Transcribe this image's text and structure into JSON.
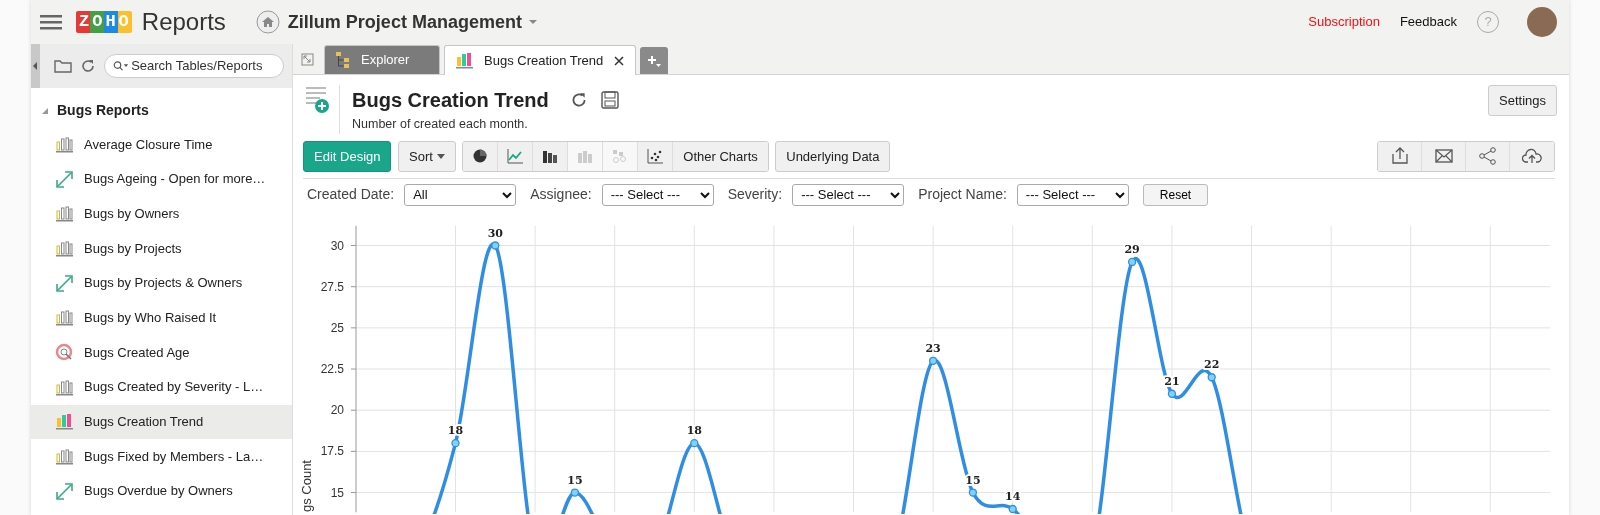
{
  "header": {
    "brand": "ZOHO",
    "app_name": "Reports",
    "workspace": "Zillum Project Management",
    "links": [
      {
        "label": "Subscription",
        "kind": "upgrade"
      },
      {
        "label": "Feedback",
        "kind": "plain"
      }
    ],
    "help": "?"
  },
  "sidebar": {
    "search": {
      "placeholder": "Search Tables/Reports"
    },
    "section": {
      "title": "Bugs Reports",
      "expanded": true
    },
    "items": [
      {
        "label": "Average Closure Time",
        "kind": "bar",
        "selected": false
      },
      {
        "label": "Bugs Ageing - Open for more…",
        "kind": "pivot",
        "selected": false
      },
      {
        "label": "Bugs by Owners",
        "kind": "bar",
        "selected": false
      },
      {
        "label": "Bugs by Projects",
        "kind": "bar",
        "selected": false
      },
      {
        "label": "Bugs by Projects & Owners",
        "kind": "pivot",
        "selected": false
      },
      {
        "label": "Bugs by Who Raised It",
        "kind": "bar",
        "selected": false
      },
      {
        "label": "Bugs Created Age",
        "kind": "dial",
        "selected": false
      },
      {
        "label": "Bugs Created by Severity - L…",
        "kind": "bar",
        "selected": false
      },
      {
        "label": "Bugs Creation Trend",
        "kind": "bar",
        "selected": true
      },
      {
        "label": "Bugs Fixed by Members - La…",
        "kind": "bar",
        "selected": false
      },
      {
        "label": "Bugs Overdue by Owners",
        "kind": "pivot",
        "selected": false
      }
    ]
  },
  "tabs": [
    {
      "label": "Explorer",
      "kind": "explorer",
      "selected": false
    },
    {
      "label": "Bugs Creation Trend",
      "kind": "chart",
      "selected": true
    }
  ],
  "report": {
    "title": "Bugs Creation Trend",
    "description": "Number of created each month.",
    "settings_button": "Settings",
    "toolbar": {
      "edit_button": "Edit Design",
      "sort_button": "Sort",
      "chart_types": [
        {
          "kind": "pie",
          "disabled": false
        },
        {
          "kind": "line",
          "disabled": false
        },
        {
          "kind": "bar",
          "disabled": false
        },
        {
          "kind": "stacked",
          "disabled": true
        },
        {
          "kind": "heatmap",
          "disabled": true
        },
        {
          "kind": "scatter",
          "disabled": false
        }
      ],
      "other_charts_button": "Other Charts",
      "underlying_data_button": "Underlying Data",
      "actions": [
        {
          "kind": "export"
        },
        {
          "kind": "mail"
        },
        {
          "kind": "share"
        },
        {
          "kind": "publish"
        }
      ]
    },
    "filters": [
      {
        "label": "Created Date:",
        "value": "All"
      },
      {
        "label": "Assignee:",
        "value": "--- Select ---"
      },
      {
        "label": "Severity:",
        "value": "--- Select ---"
      },
      {
        "label": "Project Name:",
        "value": "--- Select ---"
      }
    ],
    "reset_button": "Reset",
    "chart_data": {
      "type": "line",
      "ylabel": "gs Count",
      "grid": true,
      "categories": [
        null,
        null,
        null,
        null,
        null,
        null,
        null,
        null,
        null,
        null,
        null,
        null,
        null,
        null,
        null,
        null,
        null,
        null,
        null,
        null,
        null,
        null,
        null,
        null,
        null,
        null,
        null,
        null,
        null,
        null
      ],
      "ylim": [
        13.8,
        31.2
      ],
      "yticks": [
        {
          "value": 30,
          "label": "30"
        },
        {
          "value": 27.5,
          "label": "27.5"
        },
        {
          "value": 25,
          "label": "25"
        },
        {
          "value": 22.5,
          "label": "22.5"
        },
        {
          "value": 20,
          "label": "20"
        },
        {
          "value": 17.5,
          "label": "17.5"
        },
        {
          "value": 15,
          "label": "15"
        }
      ],
      "data_labels": true,
      "series": [
        {
          "color": "#2f8de4",
          "marker": "circle",
          "values": [
            null,
            null,
            18,
            30,
            null,
            15,
            null,
            null,
            18,
            null,
            null,
            null,
            null,
            null,
            23,
            15,
            14,
            null,
            null,
            29,
            21,
            22,
            null,
            null,
            null,
            null,
            null,
            null,
            null,
            null
          ]
        }
      ]
    }
  }
}
